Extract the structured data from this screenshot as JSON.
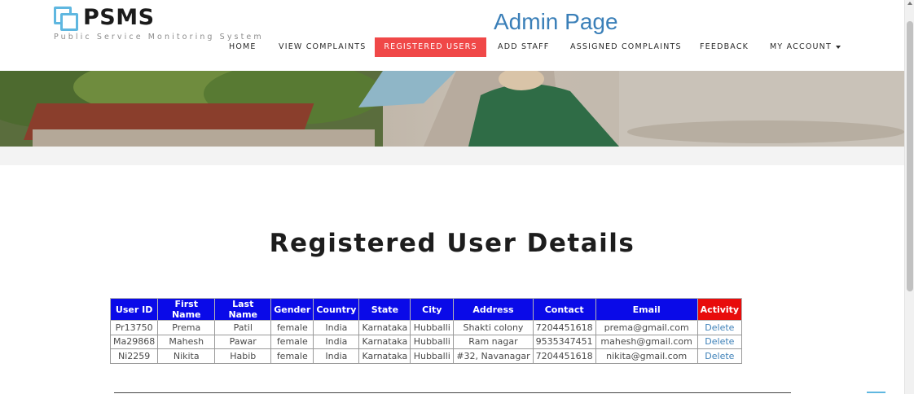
{
  "brand": {
    "title": "PSMS",
    "subtitle": "Public Service Monitoring System",
    "accent_color": "#5fb7e0"
  },
  "page_heading": "Admin Page",
  "nav": {
    "items": [
      {
        "label": "HOME"
      },
      {
        "label": "VIEW COMPLAINTS"
      },
      {
        "label": "REGISTERED USERS",
        "active": true
      },
      {
        "label": "ADD STAFF"
      },
      {
        "label": "ASSIGNED COMPLAINTS"
      },
      {
        "label": "FEEDBACK"
      },
      {
        "label": "MY ACCOUNT",
        "icon": "caret-down-icon"
      }
    ],
    "active_color": "#f04848"
  },
  "section_title": "Registered User Details",
  "table": {
    "headers": [
      "User ID",
      "First Name",
      "Last Name",
      "Gender",
      "Country",
      "State",
      "City",
      "Address",
      "Contact",
      "Email",
      "Activity"
    ],
    "header_color": "#0a0ae8",
    "activity_header_color": "#e80c0c",
    "rows": [
      [
        "Pr13750",
        "Prema",
        "Patil",
        "female",
        "India",
        "Karnataka",
        "Hubballi",
        "Shakti colony",
        "7204451618",
        "prema@gmail.com",
        "Delete"
      ],
      [
        "Ma29868",
        "Mahesh",
        "Pawar",
        "female",
        "India",
        "Karnataka",
        "Hubballi",
        "Ram nagar",
        "9535347451",
        "mahesh@gmail.com",
        "Delete"
      ],
      [
        "Ni2259",
        "Nikita",
        "Habib",
        "female",
        "India",
        "Karnataka",
        "Hubballi",
        "#32, Navanagar",
        "7204451618",
        "nikita@gmail.com",
        "Delete"
      ]
    ]
  }
}
